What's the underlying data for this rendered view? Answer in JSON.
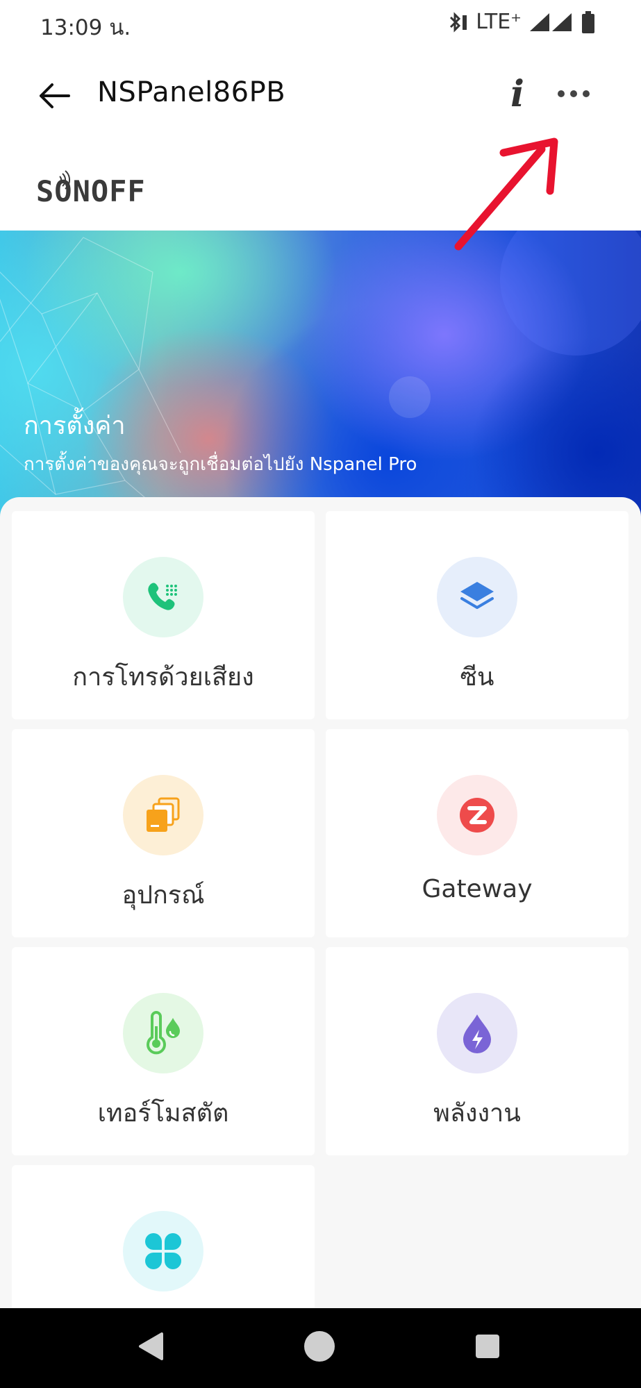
{
  "status_bar": {
    "time": "13:09 น.",
    "network": "LTE⁺"
  },
  "app_bar": {
    "title": "NSPanel86PB",
    "info_label": "i",
    "back_icon": "arrow-left-icon",
    "more_icon": "more-horizontal-icon"
  },
  "brand": {
    "name": "SONOFF"
  },
  "hero": {
    "title": "การตั้งค่า",
    "subtitle": "การตั้งค่าของคุณจะถูกเชื่อมต่อไปยัง Nspanel Pro"
  },
  "tiles": [
    {
      "label": "การโทรด้วยเสียง",
      "icon": "phone-dialpad-icon",
      "bg": "#e3f8ee",
      "fg": "#1ec27a"
    },
    {
      "label": "ซีน",
      "icon": "layers-icon",
      "bg": "#e6eefb",
      "fg": "#3a7fe0"
    },
    {
      "label": "อุปกรณ์",
      "icon": "device-stack-icon",
      "bg": "#fdefd6",
      "fg": "#f7a21b"
    },
    {
      "label": "Gateway",
      "icon": "zigbee-icon",
      "bg": "#fde9e9",
      "fg": "#ee4b4b"
    },
    {
      "label": "เทอร์โมสตัต",
      "icon": "thermometer-drop-icon",
      "bg": "#e4f8e4",
      "fg": "#5acb5a"
    },
    {
      "label": "พลังงาน",
      "icon": "energy-drop-icon",
      "bg": "#e8e6f8",
      "fg": "#7a64d6"
    },
    {
      "label": "",
      "icon": "four-petal-grid-icon",
      "bg": "#e2f8fa",
      "fg": "#1cc6d6"
    }
  ],
  "nav": {
    "back_icon": "nav-back-triangle-icon",
    "home_icon": "nav-home-circle-icon",
    "recents_icon": "nav-recents-square-icon"
  },
  "colors": {
    "annotation_arrow": "#e8132f",
    "content_bg": "#f7f7f7",
    "nav_bg": "#000000"
  }
}
